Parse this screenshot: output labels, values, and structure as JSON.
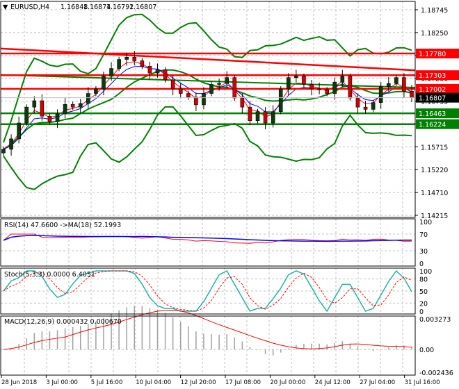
{
  "header": {
    "symbol": "EURUSD,H4",
    "open": "1.16848",
    "high": "1.16874",
    "low": "1.16792",
    "close": "1.16807"
  },
  "chart_data": {
    "type": "candlestick",
    "title": "EURUSD,H4 1.16848 1.16874 1.16792 1.16807",
    "price_ticks": [
      "1.18745",
      "1.18250",
      "1.17740",
      "1.17230",
      "1.16735",
      "1.16225",
      "1.15715",
      "1.15220",
      "1.14710",
      "1.14215"
    ],
    "price_range": [
      1.14215,
      1.18745
    ],
    "time_ticks": [
      "28 Jun 2018",
      "3 Jul 00:00",
      "5 Jul 16:00",
      "10 Jul 04:00",
      "12 Jul 20:00",
      "17 Jul 08:00",
      "20 Jul 00:00",
      "24 Jul 12:00",
      "27 Jul 04:00",
      "31 Jul 16:00"
    ],
    "closes": [
      1.1567,
      1.159,
      1.1625,
      1.166,
      1.1674,
      1.164,
      1.1628,
      1.1645,
      1.1666,
      1.166,
      1.1668,
      1.169,
      1.17,
      1.1728,
      1.1745,
      1.1765,
      1.177,
      1.1762,
      1.175,
      1.1735,
      1.1742,
      1.172,
      1.17,
      1.169,
      1.1682,
      1.1665,
      1.169,
      1.171,
      1.1712,
      1.1725,
      1.168,
      1.166,
      1.163,
      1.165,
      1.1625,
      1.165,
      1.17,
      1.1725,
      1.1728,
      1.171,
      1.17,
      1.1698,
      1.169,
      1.1715,
      1.1728,
      1.168,
      1.166,
      1.1655,
      1.167,
      1.1705,
      1.1712,
      1.1725,
      1.1695,
      1.16807
    ],
    "levels": [
      {
        "value": 1.1778,
        "label": "1.17780",
        "color": "#ff0000"
      },
      {
        "value": 1.17303,
        "label": "1.17303",
        "color": "#ff0000"
      },
      {
        "value": 1.17002,
        "label": "1.17002",
        "color": "#ff0000"
      },
      {
        "value": 1.16463,
        "label": "1.16463",
        "color": "#008000"
      },
      {
        "value": 1.16224,
        "label": "1.16224",
        "color": "#008000"
      }
    ],
    "current_price": {
      "value": 1.16807,
      "label": "1.16807"
    },
    "trendline": {
      "start": 1.1789,
      "end": 1.1741,
      "color": "#ff0000"
    },
    "long_ma": {
      "start": 1.1731,
      "end": 1.1703,
      "color": "#008000"
    },
    "rsi": {
      "label": "RSI(14) 47.6600  ->MA(18) 52.1993",
      "ticks": [
        "100",
        "70",
        "30",
        "0"
      ]
    },
    "stoch": {
      "label": "Stoch(5,3,3) 0.0000 6.4051",
      "ticks": [
        "100",
        "80",
        "50",
        "20",
        "0"
      ]
    },
    "macd": {
      "label": "MACD(12,26,9) 0.000432 0.000670",
      "ticks": [
        "0.003273",
        "0.00",
        "-0.002436"
      ],
      "range": [
        -0.002436,
        0.003273
      ]
    }
  }
}
